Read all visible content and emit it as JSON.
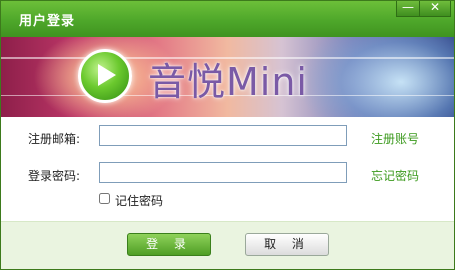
{
  "window": {
    "title": "用户登录",
    "minimize_label": "—",
    "close_label": "✕"
  },
  "banner": {
    "brand_text": "音悦Mini",
    "logo_icon": "play-icon"
  },
  "form": {
    "email_label": "注册邮箱:",
    "email_value": "",
    "register_link": "注册账号",
    "password_label": "登录密码:",
    "password_value": "",
    "forgot_link": "忘记密码",
    "remember_label": "记住密码",
    "remember_checked": false
  },
  "buttons": {
    "login_label": "登 录",
    "cancel_label": "取 消"
  },
  "colors": {
    "title_bar": "#4ea72a",
    "link": "#3c9a1e",
    "footer_bg": "#eaf4e0",
    "brand_text": "#7a5aa6"
  }
}
